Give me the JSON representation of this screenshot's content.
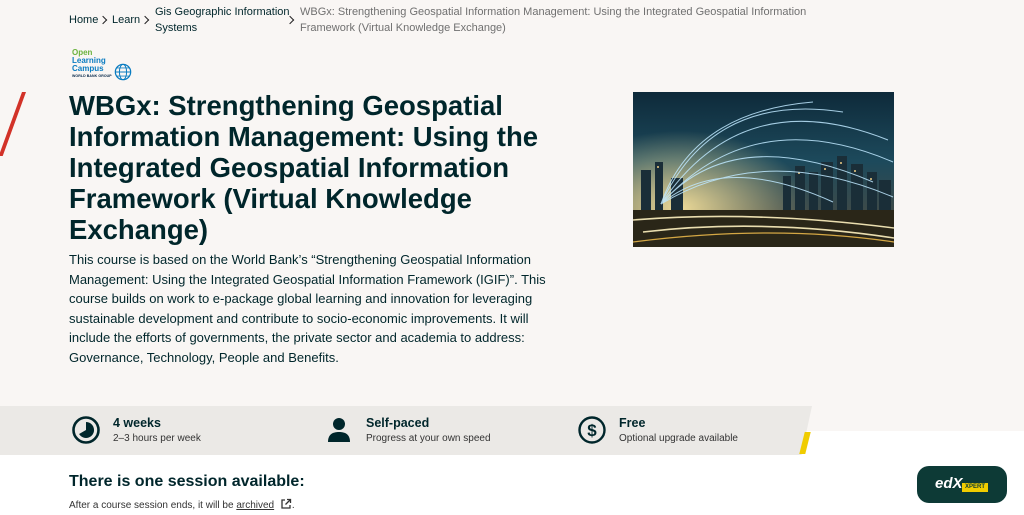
{
  "breadcrumb": {
    "home": "Home",
    "learn": "Learn",
    "category_line1": "Gis Geographic Information",
    "category_line2": "Systems",
    "current_line1": "WBGx: Strengthening Geospatial Information Management: Using the Integrated Geospatial Information",
    "current_line2": "Framework (Virtual Knowledge Exchange)"
  },
  "logo": {
    "line1": "Open",
    "line2": "Learning",
    "line3": "Campus",
    "line4": "WORLD BANK GROUP"
  },
  "course": {
    "title": "WBGx: Strengthening Geospatial Information Management: Using the Integrated Geospatial Information Framework (Virtual Knowledge Exchange)",
    "description": "This course is based on the World Bank’s “Strengthening Geospatial Information Management: Using the Integrated Geospatial Information Framework (IGIF)”. This course builds on work to e-package global learning and innovation for leveraging sustainable development and contribute to socio-economic improvements. It will include the efforts of governments, the private sector and academia to address: Governance, Technology, People and Benefits."
  },
  "facts": [
    {
      "icon": "clock-icon",
      "title": "4 weeks",
      "subtitle": "2–3 hours per week"
    },
    {
      "icon": "person-icon",
      "title": "Self-paced",
      "subtitle": "Progress at your own speed"
    },
    {
      "icon": "dollar-icon",
      "title": "Free",
      "subtitle": "Optional upgrade available"
    }
  ],
  "session": {
    "title": "There is one session available:",
    "note_prefix": "After a course session ends, it will be ",
    "note_link": "archived",
    "note_suffix": "."
  },
  "xpert": {
    "brand": "edX",
    "tag": "XPERT"
  },
  "colors": {
    "hero_bg": "#f9f6f4",
    "text": "#00262b",
    "accent_red": "#d23228",
    "accent_yellow": "#f0cc00",
    "xpert_bg": "#0d3a36"
  }
}
